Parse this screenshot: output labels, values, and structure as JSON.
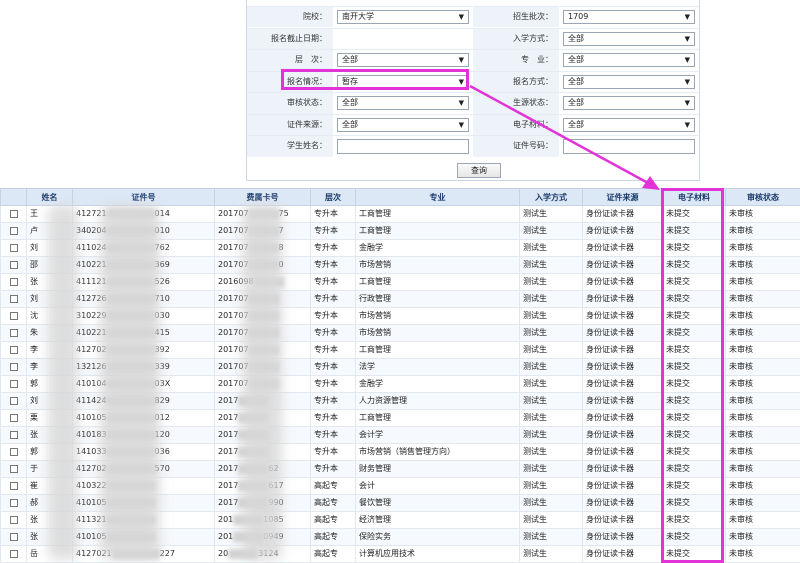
{
  "filters": {
    "school": {
      "label": "院校：",
      "value": "南开大学"
    },
    "batch": {
      "label": "招生批次：",
      "value": "1709"
    },
    "deadline": {
      "label": "报名截止日期：",
      "value": ""
    },
    "entry_mode": {
      "label": "入学方式：",
      "value": "全部"
    },
    "level": {
      "label": "层　次：",
      "value": "全部"
    },
    "major": {
      "label": "专　业：",
      "value": "全部"
    },
    "reg_status": {
      "label": "报名情况：",
      "value": "暂存"
    },
    "reg_method": {
      "label": "报名方式：",
      "value": "全部"
    },
    "review_status": {
      "label": "审核状态：",
      "value": "全部"
    },
    "student_source": {
      "label": "生源状态：",
      "value": "全部"
    },
    "id_source": {
      "label": "证件来源：",
      "value": "全部"
    },
    "e_material": {
      "label": "电子材料：",
      "value": "全部"
    },
    "student_name": {
      "label": "学生姓名：",
      "value": ""
    },
    "id_number": {
      "label": "证件号码：",
      "value": ""
    },
    "query_label": "查询"
  },
  "table": {
    "headers": [
      "",
      "姓名",
      "证件号",
      "费属卡号",
      "层次",
      "专业",
      "入学方式",
      "证件来源",
      "电子材料",
      "审核状态"
    ],
    "rows": [
      {
        "name": "王",
        "id": "412721",
        "id_tail": "014",
        "card": "201707",
        "card_tail": "75",
        "level": "专升本",
        "major": "工商管理",
        "entry": "测试生",
        "source": "身份证读卡器",
        "material": "未提交",
        "review": "未审核"
      },
      {
        "name": "卢",
        "id": "340204",
        "id_tail": "010",
        "card": "201707",
        "card_tail": "7",
        "level": "专升本",
        "major": "工商管理",
        "entry": "测试生",
        "source": "身份证读卡器",
        "material": "未提交",
        "review": "未审核"
      },
      {
        "name": "刘",
        "id": "411024",
        "id_tail": "762",
        "card": "201707",
        "card_tail": "8",
        "level": "专升本",
        "major": "金融学",
        "entry": "测试生",
        "source": "身份证读卡器",
        "material": "未提交",
        "review": "未审核"
      },
      {
        "name": "邵",
        "id": "410221",
        "id_tail": "369",
        "card": "201707",
        "card_tail": "0",
        "level": "专升本",
        "major": "市场营销",
        "entry": "测试生",
        "source": "身份证读卡器",
        "material": "未提交",
        "review": "未审核"
      },
      {
        "name": "张",
        "id": "411121",
        "id_tail": "526",
        "card": "2016098",
        "card_tail": "",
        "level": "专升本",
        "major": "工商管理",
        "entry": "测试生",
        "source": "身份证读卡器",
        "material": "未提交",
        "review": "未审核"
      },
      {
        "name": "刘",
        "id": "412726",
        "id_tail": "710",
        "card": "201707",
        "card_tail": "",
        "level": "专升本",
        "major": "行政管理",
        "entry": "测试生",
        "source": "身份证读卡器",
        "material": "未提交",
        "review": "未审核"
      },
      {
        "name": "沈",
        "id": "310229",
        "id_tail": "030",
        "card": "201707",
        "card_tail": "",
        "level": "专升本",
        "major": "市场营销",
        "entry": "测试生",
        "source": "身份证读卡器",
        "material": "未提交",
        "review": "未审核"
      },
      {
        "name": "朱",
        "id": "410221",
        "id_tail": "415",
        "card": "201707",
        "card_tail": "",
        "level": "专升本",
        "major": "市场营销",
        "entry": "测试生",
        "source": "身份证读卡器",
        "material": "未提交",
        "review": "未审核"
      },
      {
        "name": "李",
        "id": "412702",
        "id_tail": "392",
        "card": "201707",
        "card_tail": "",
        "level": "专升本",
        "major": "工商管理",
        "entry": "测试生",
        "source": "身份证读卡器",
        "material": "未提交",
        "review": "未审核"
      },
      {
        "name": "李",
        "id": "132126",
        "id_tail": "339",
        "card": "201707",
        "card_tail": "",
        "level": "专升本",
        "major": "法学",
        "entry": "测试生",
        "source": "身份证读卡器",
        "material": "未提交",
        "review": "未审核"
      },
      {
        "name": "郭",
        "id": "410104",
        "id_tail": "03X",
        "card": "201707",
        "card_tail": "",
        "level": "专升本",
        "major": "金融学",
        "entry": "测试生",
        "source": "身份证读卡器",
        "material": "未提交",
        "review": "未审核"
      },
      {
        "name": "刘",
        "id": "411424",
        "id_tail": "829",
        "card": "2017",
        "card_tail": "",
        "level": "专升本",
        "major": "人力资源管理",
        "entry": "测试生",
        "source": "身份证读卡器",
        "material": "未提交",
        "review": "未审核"
      },
      {
        "name": "栗",
        "id": "410105",
        "id_tail": "012",
        "card": "2017",
        "card_tail": "",
        "level": "专升本",
        "major": "工商管理",
        "entry": "测试生",
        "source": "身份证读卡器",
        "material": "未提交",
        "review": "未审核"
      },
      {
        "name": "张",
        "id": "410183",
        "id_tail": "120",
        "card": "2017",
        "card_tail": "",
        "level": "专升本",
        "major": "会计学",
        "entry": "测试生",
        "source": "身份证读卡器",
        "material": "未提交",
        "review": "未审核"
      },
      {
        "name": "郭",
        "id": "141033",
        "id_tail": "036",
        "card": "2017",
        "card_tail": "",
        "level": "专升本",
        "major": "市场营销（销售管理方向）",
        "entry": "测试生",
        "source": "身份证读卡器",
        "material": "未提交",
        "review": "未审核"
      },
      {
        "name": "于",
        "id": "412702",
        "id_tail": "570",
        "card": "2017",
        "card_tail": "62",
        "level": "专升本",
        "major": "财务管理",
        "entry": "测试生",
        "source": "身份证读卡器",
        "material": "未提交",
        "review": "未审核"
      },
      {
        "name": "崔",
        "id": "410322",
        "id_tail": "",
        "card": "2017",
        "card_tail": "617",
        "level": "高起专",
        "major": "会计",
        "entry": "测试生",
        "source": "身份证读卡器",
        "material": "未提交",
        "review": "未审核"
      },
      {
        "name": "郝",
        "id": "410105",
        "id_tail": "",
        "card": "2017",
        "card_tail": "990",
        "level": "高起专",
        "major": "餐饮管理",
        "entry": "测试生",
        "source": "身份证读卡器",
        "material": "未提交",
        "review": "未审核"
      },
      {
        "name": "张",
        "id": "411321",
        "id_tail": "",
        "card": "201",
        "card_tail": "1085",
        "level": "高起专",
        "major": "经济管理",
        "entry": "测试生",
        "source": "身份证读卡器",
        "material": "未提交",
        "review": "未审核"
      },
      {
        "name": "张",
        "id": "410105",
        "id_tail": "",
        "card": "201",
        "card_tail": "0949",
        "level": "高起专",
        "major": "保险实务",
        "entry": "测试生",
        "source": "身份证读卡器",
        "material": "未提交",
        "review": "未审核"
      },
      {
        "name": "岳",
        "id": "4127021",
        "id_tail": "227",
        "card": "20",
        "card_tail": "3124",
        "level": "高起专",
        "major": "计算机应用技术",
        "entry": "测试生",
        "source": "身份证读卡器",
        "material": "未提交",
        "review": "未审核"
      }
    ]
  },
  "colors": {
    "annotation": "#e233d8",
    "header_bg": "#dde8f6",
    "label_bg": "#eef3fa"
  },
  "icons": {
    "dropdown": "chevron-down-icon"
  }
}
